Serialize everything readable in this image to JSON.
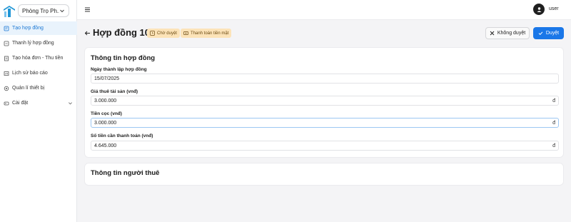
{
  "sidebar": {
    "property_select": "Phòng Trọ Ph...",
    "items": [
      {
        "label": "Tạo hợp đồng",
        "icon": "contract-icon",
        "active": true
      },
      {
        "label": "Thanh lý hợp đồng",
        "icon": "liquidation-icon",
        "active": false
      },
      {
        "label": "Tạo hóa đơn - Thu tiền",
        "icon": "invoice-icon",
        "active": false
      },
      {
        "label": "Lịch sử báo cáo",
        "icon": "history-icon",
        "active": false
      },
      {
        "label": "Quản lí thiết bị",
        "icon": "device-icon",
        "active": false
      },
      {
        "label": "Cài đặt",
        "icon": "settings-icon",
        "active": false
      }
    ]
  },
  "topbar": {
    "user_name": "user"
  },
  "header": {
    "title": "Hợp đồng 104",
    "badge_status": "Chờ duyệt",
    "badge_payment": "Thanh toán tiền mặt",
    "reject_label": "Không duyệt",
    "approve_label": "Duyệt"
  },
  "contract_card": {
    "title": "Thông tin hợp đồng",
    "fields": [
      {
        "label": "Ngày thành lập hợp đồng",
        "value": "15/07/2025",
        "unit": ""
      },
      {
        "label": "Giá thuê tài sản (vnđ)",
        "value": "3.000.000",
        "unit": "đ"
      },
      {
        "label": "Tiền cọc (vnđ)",
        "value": "3.000.000",
        "unit": "đ"
      },
      {
        "label": "Số tiền cần thanh toán (vnđ)",
        "value": "4.645.000",
        "unit": "đ"
      }
    ]
  },
  "tenant_card": {
    "title": "Thông tin người thuê"
  },
  "colors": {
    "accent": "#1a77e8",
    "active_nav_bg": "#e9f3fc",
    "badge_bg": "#fce3b8",
    "logo": "#2196d6"
  }
}
